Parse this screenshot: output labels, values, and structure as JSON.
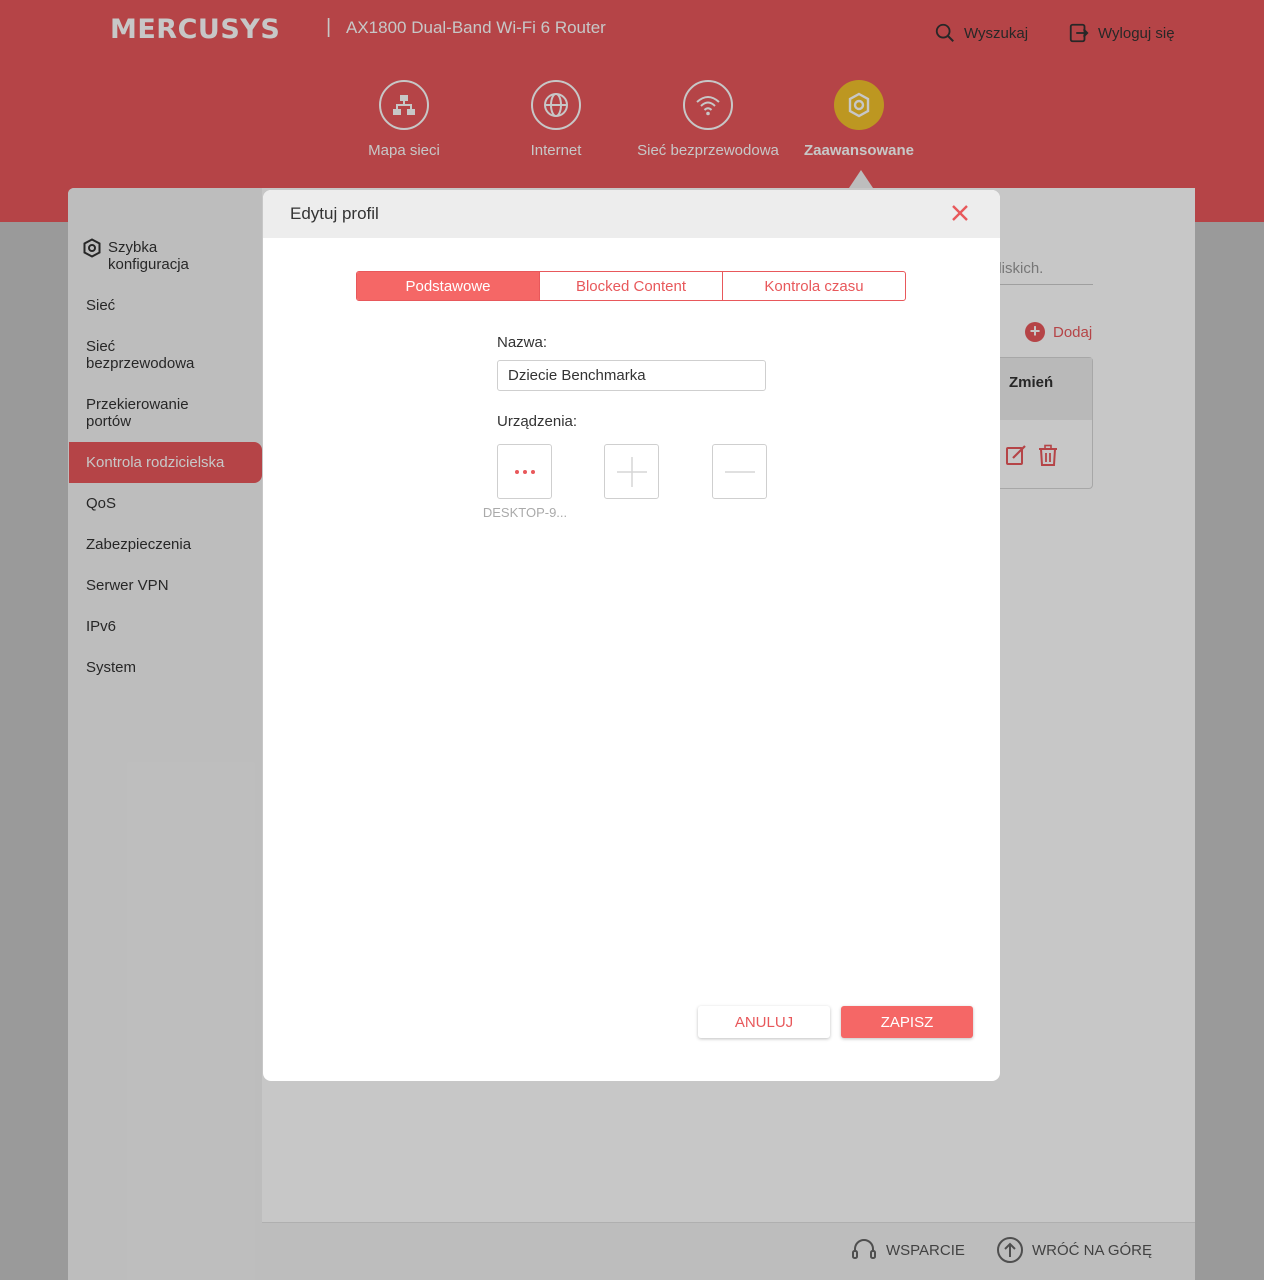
{
  "header": {
    "brand": "MERCUSYS",
    "separator": "|",
    "model": "AX1800 Dual-Band Wi-Fi 6 Router",
    "search_label": "Wyszukaj",
    "logout_label": "Wyloguj się"
  },
  "nav": {
    "tabs": [
      {
        "label": "Mapa sieci",
        "icon": "network-map-icon"
      },
      {
        "label": "Internet",
        "icon": "globe-icon"
      },
      {
        "label": "Sieć bezprzewodowa",
        "icon": "wifi-icon"
      },
      {
        "label": "Zaawansowane",
        "icon": "gear-icon",
        "active": true
      }
    ]
  },
  "sidebar": {
    "items": [
      {
        "label": "Szybka konfiguracja"
      },
      {
        "label": "Sieć"
      },
      {
        "label": "Sieć bezprzewodowa"
      },
      {
        "label": "Przekierowanie portów"
      },
      {
        "label": "Kontrola rodzicielska",
        "active": true
      },
      {
        "label": "QoS"
      },
      {
        "label": "Zabezpieczenia"
      },
      {
        "label": "Serwer VPN"
      },
      {
        "label": "IPv6"
      },
      {
        "label": "System"
      }
    ]
  },
  "background": {
    "search_hint": "bliskich.",
    "add_label": "Dodaj",
    "table_header_modify": "Zmień"
  },
  "footer": {
    "support_label": "WSPARCIE",
    "back_to_top_label": "WRÓĆ NA GÓRĘ"
  },
  "modal": {
    "title": "Edytuj profil",
    "tabs": [
      {
        "label": "Podstawowe",
        "active": true
      },
      {
        "label": "Blocked Content"
      },
      {
        "label": "Kontrola czasu"
      }
    ],
    "name_label": "Nazwa:",
    "name_value": "Dziecie Benchmarka",
    "devices_label": "Urządzenia:",
    "devices": [
      {
        "name": "DESKTOP-9..."
      }
    ],
    "cancel_label": "ANULUJ",
    "save_label": "ZAPISZ"
  },
  "colors": {
    "brand_red": "#e8585b",
    "tab_active": "#f56766",
    "active_nav_circle": "#f2c22b"
  }
}
